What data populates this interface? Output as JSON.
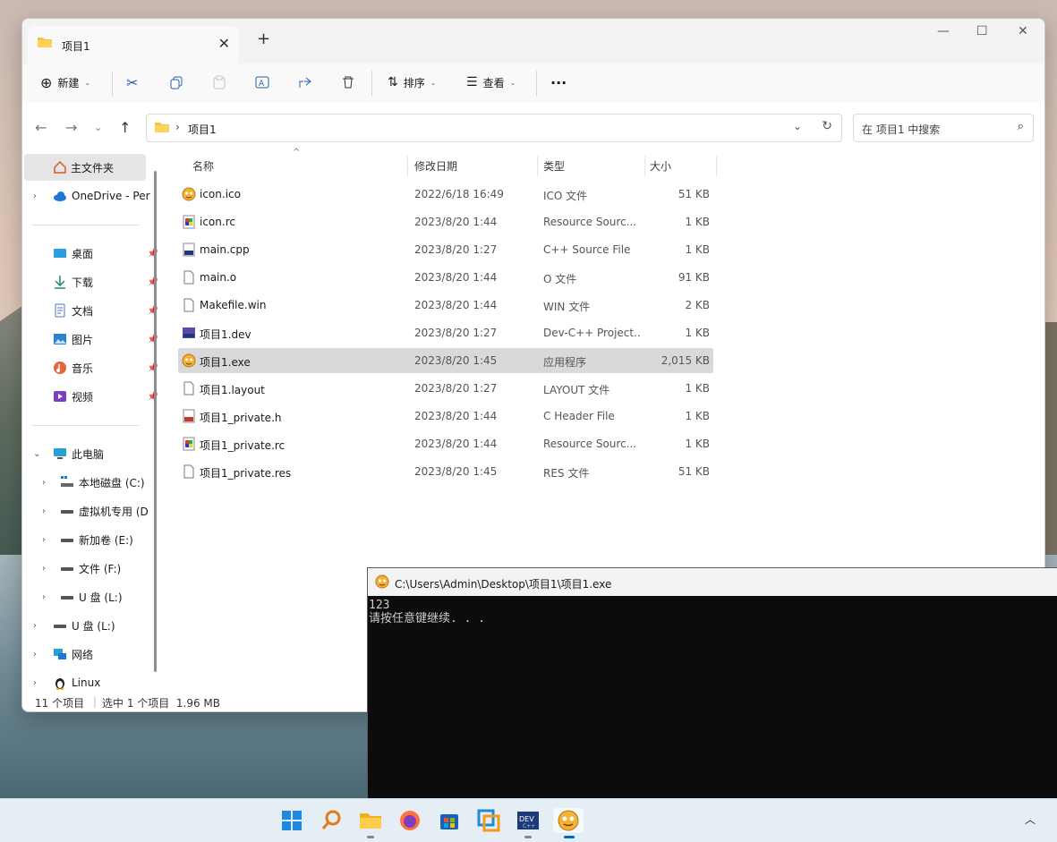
{
  "explorer": {
    "tab_title": "项目1",
    "toolbar": {
      "new_label": "新建",
      "sort_label": "排序",
      "view_label": "查看",
      "more_label": "···"
    },
    "address": {
      "path": "项目1"
    },
    "search": {
      "placeholder": "在 项目1 中搜索"
    },
    "sidebar": {
      "home": "主文件夹",
      "onedrive": "OneDrive - Per",
      "quick": [
        {
          "label": "桌面"
        },
        {
          "label": "下载"
        },
        {
          "label": "文档"
        },
        {
          "label": "图片"
        },
        {
          "label": "音乐"
        },
        {
          "label": "视频"
        }
      ],
      "thispc": "此电脑",
      "drives": [
        {
          "label": "本地磁盘 (C:)"
        },
        {
          "label": "虚拟机专用 (D"
        },
        {
          "label": "新加卷 (E:)"
        },
        {
          "label": "文件 (F:)"
        },
        {
          "label": "U 盘 (L:)"
        }
      ],
      "usb": "U 盘 (L:)",
      "network": "网络",
      "linux": "Linux"
    },
    "columns": {
      "name": "名称",
      "date": "修改日期",
      "type": "类型",
      "size": "大小"
    },
    "files": [
      {
        "name": "icon.ico",
        "date": "2022/6/18 16:49",
        "type": "ICO 文件",
        "size": "51 KB"
      },
      {
        "name": "icon.rc",
        "date": "2023/8/20 1:44",
        "type": "Resource Sourc...",
        "size": "1 KB"
      },
      {
        "name": "main.cpp",
        "date": "2023/8/20 1:27",
        "type": "C++ Source File",
        "size": "1 KB"
      },
      {
        "name": "main.o",
        "date": "2023/8/20 1:44",
        "type": "O 文件",
        "size": "91 KB"
      },
      {
        "name": "Makefile.win",
        "date": "2023/8/20 1:44",
        "type": "WIN 文件",
        "size": "2 KB"
      },
      {
        "name": "项目1.dev",
        "date": "2023/8/20 1:27",
        "type": "Dev-C++ Project...",
        "size": "1 KB"
      },
      {
        "name": "项目1.exe",
        "date": "2023/8/20 1:45",
        "type": "应用程序",
        "size": "2,015 KB",
        "selected": true
      },
      {
        "name": "项目1.layout",
        "date": "2023/8/20 1:27",
        "type": "LAYOUT 文件",
        "size": "1 KB"
      },
      {
        "name": "项目1_private.h",
        "date": "2023/8/20 1:44",
        "type": "C Header File",
        "size": "1 KB"
      },
      {
        "name": "项目1_private.rc",
        "date": "2023/8/20 1:44",
        "type": "Resource Sourc...",
        "size": "1 KB"
      },
      {
        "name": "项目1_private.res",
        "date": "2023/8/20 1:45",
        "type": "RES 文件",
        "size": "51 KB"
      }
    ],
    "status": {
      "count": "11 个项目",
      "selection": "选中 1 个项目  1.96 MB"
    }
  },
  "console": {
    "title": "C:\\Users\\Admin\\Desktop\\项目1\\项目1.exe",
    "line1": "123",
    "line2": "请按任意键继续. . ."
  },
  "colors": {
    "accent": "#0067c0",
    "folder": "#f8c23a",
    "console_bg": "#0c0c0c"
  }
}
